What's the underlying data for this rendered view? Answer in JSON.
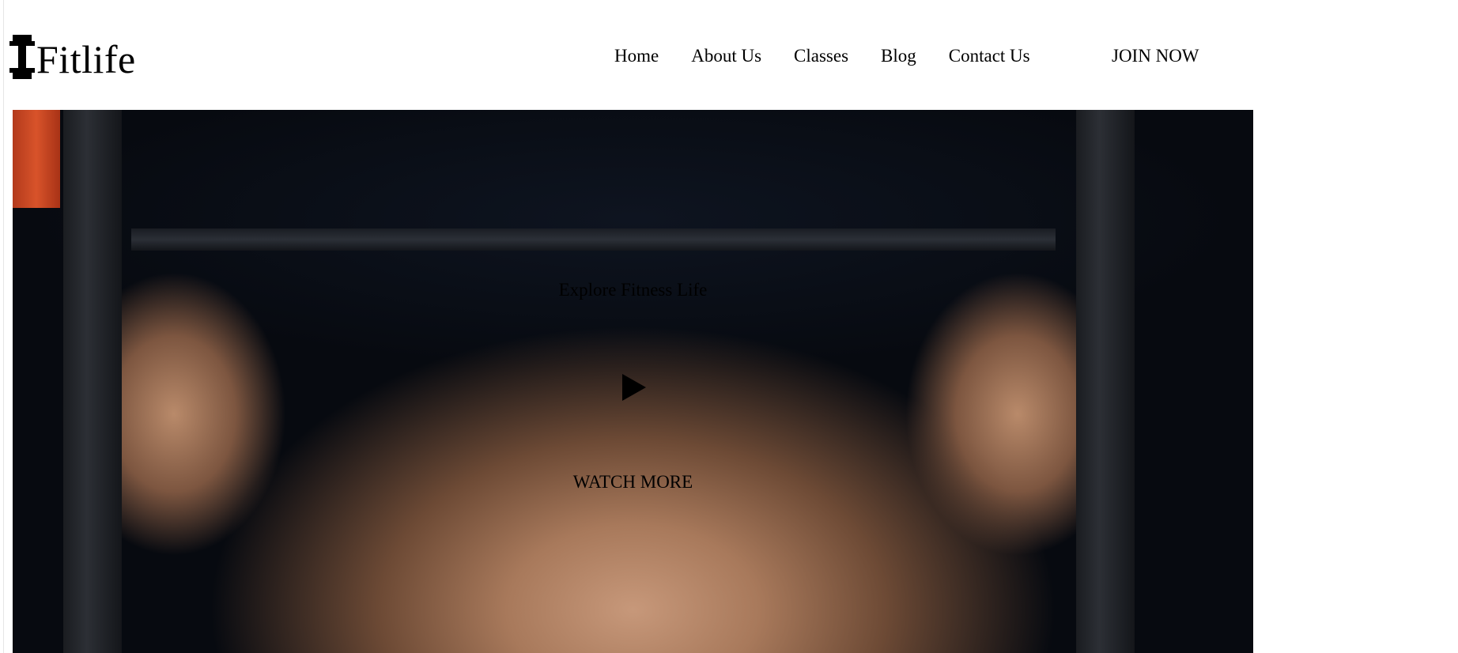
{
  "brand": {
    "name": "Fitlife",
    "icon": "dumbbell-icon"
  },
  "nav": {
    "items": [
      {
        "label": "Home"
      },
      {
        "label": "About Us"
      },
      {
        "label": "Classes"
      },
      {
        "label": "Blog"
      },
      {
        "label": "Contact Us"
      }
    ],
    "cta_label": "JOIN NOW"
  },
  "hero": {
    "subtitle": "Explore Fitness Life",
    "play_icon": "play-icon",
    "watch_label": "WATCH MORE"
  },
  "colors": {
    "text": "#000000",
    "background": "#ffffff",
    "hero_dark": "#070a10",
    "rack_accent": "#d8532a"
  }
}
